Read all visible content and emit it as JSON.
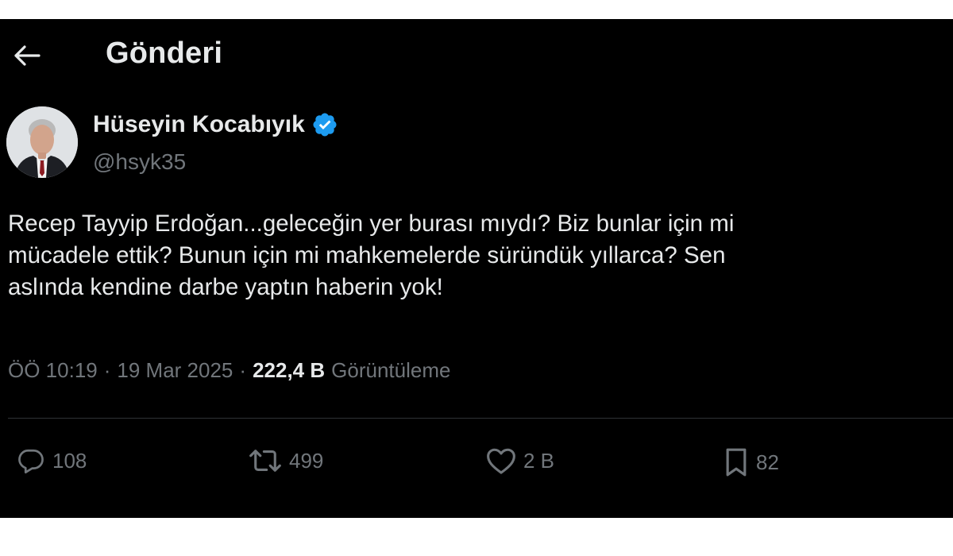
{
  "header": {
    "title": "Gönderi"
  },
  "author": {
    "name": "Hüseyin Kocabıyık",
    "handle": "@hsyk35"
  },
  "tweet": {
    "lines": [
      "Recep Tayyip Erdoğan...geleceğin yer burası mıydı? Biz bunlar için mi",
      "mücadele ettik? Bunun için mi mahkemelerde süründük yıllarca? Sen",
      "aslında kendine darbe yaptın haberin yok!"
    ]
  },
  "meta": {
    "time": "ÖÖ 10:19",
    "separator": "·",
    "date": "19 Mar 2025",
    "views_count": "222,4 B",
    "views_label": "Görüntüleme"
  },
  "actions": {
    "replies": "108",
    "reposts": "499",
    "likes": "2 B",
    "bookmarks": "82"
  },
  "colors": {
    "background": "#000000",
    "text_primary": "#e7e9ea",
    "text_secondary": "#71767b",
    "verified": "#1d9bf0",
    "divider": "#2f3336"
  },
  "icons": {
    "back": "arrow-left-icon",
    "verified": "verified-badge-icon",
    "reply": "reply-icon",
    "repost": "repost-icon",
    "like": "heart-icon",
    "bookmark": "bookmark-icon"
  }
}
